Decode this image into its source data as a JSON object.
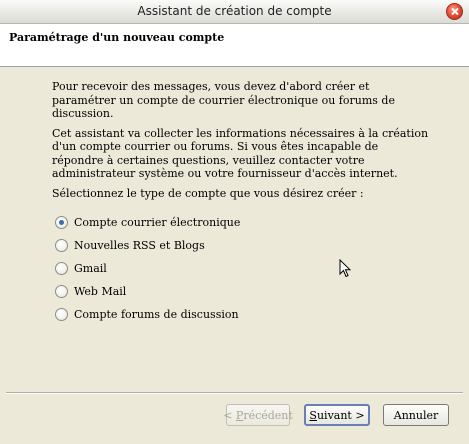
{
  "window": {
    "title": "Assistant de création de compte"
  },
  "header": {
    "title": "Paramétrage d'un nouveau compte"
  },
  "intro": {
    "paragraph1": "Pour recevoir des messages, vous devez d'abord créer et paramétrer un compte de courrier électronique ou forums de discussion.",
    "paragraph2": "Cet assistant va collecter les informations nécessaires à la création d'un compte courrier ou forums. Si vous êtes incapable de répondre à certaines questions, veuillez contacter votre administrateur système ou votre fournisseur d'accès internet.",
    "prompt": "Sélectionnez le type de compte que vous désirez créer :"
  },
  "account_types": [
    {
      "label": "Compte courrier électronique",
      "selected": true
    },
    {
      "label": "Nouvelles RSS et Blogs",
      "selected": false
    },
    {
      "label": "Gmail",
      "selected": false
    },
    {
      "label": "Web Mail",
      "selected": false
    },
    {
      "label": "Compte forums de discussion",
      "selected": false
    }
  ],
  "buttons": {
    "previous": {
      "accel": "P",
      "rest": "récédent",
      "prefix": "< "
    },
    "next": {
      "accel": "S",
      "rest": "uivant >"
    },
    "cancel": "Annuler"
  },
  "icons": {
    "close": "close-icon",
    "cursor": "mouse-pointer-icon"
  }
}
